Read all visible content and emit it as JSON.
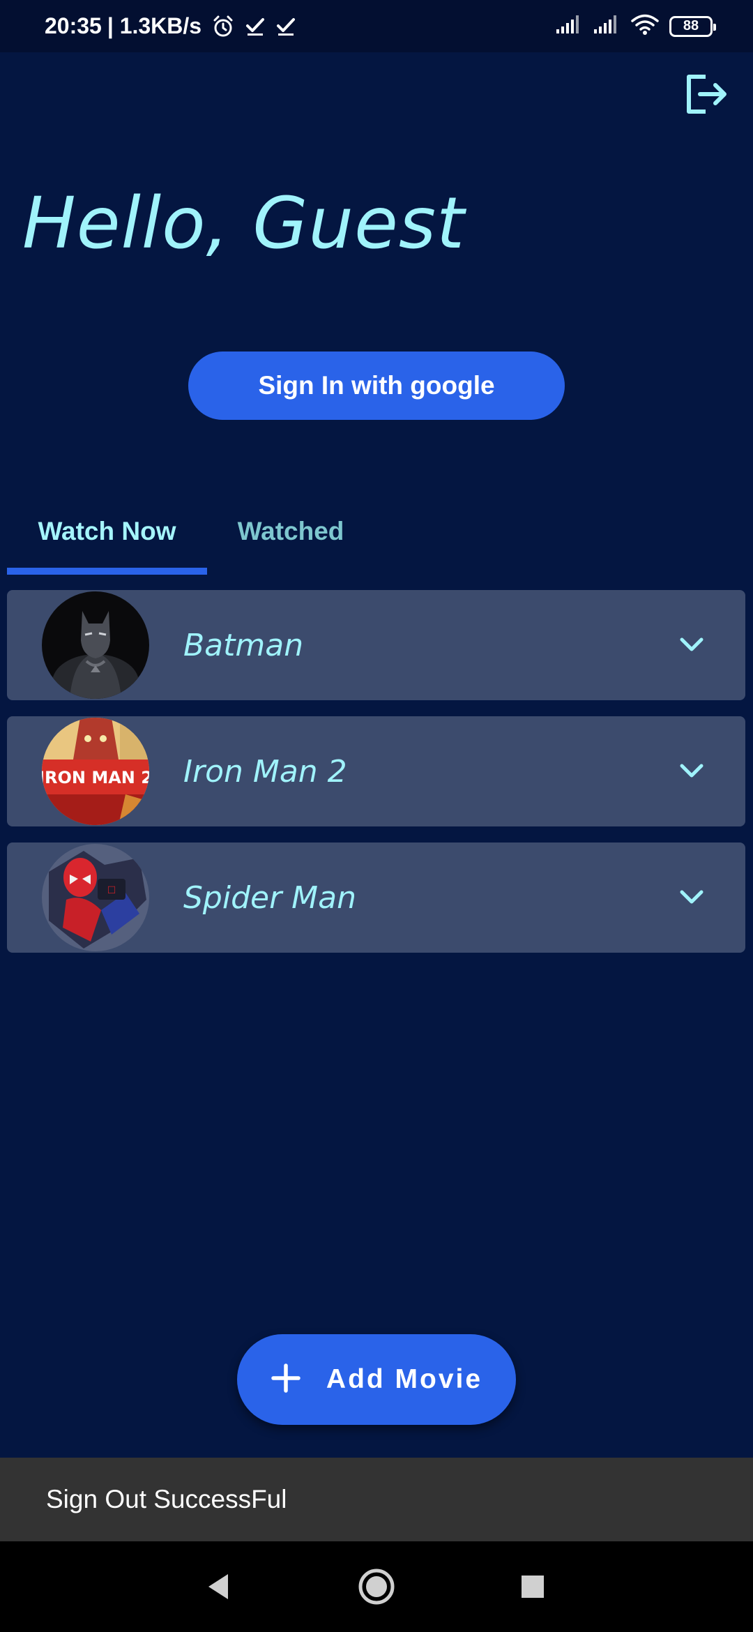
{
  "status_bar": {
    "time": "20:35",
    "network_speed": "| 1.3KB/s",
    "left_icons": [
      "alarm-icon",
      "download-done-icon",
      "download-done-icon"
    ],
    "right_icons": [
      "signal-icon",
      "signal-icon",
      "wifi-icon"
    ],
    "battery": "88"
  },
  "header": {
    "greeting": "Hello, Guest",
    "logout_icon": "logout-icon"
  },
  "auth": {
    "sign_in_label": "Sign In with google"
  },
  "tabs": [
    {
      "label": "Watch Now",
      "active": true
    },
    {
      "label": "Watched",
      "active": false
    }
  ],
  "movies": [
    {
      "title": "Batman",
      "poster": "batman-poster"
    },
    {
      "title": "Iron Man 2",
      "poster": "iron-man-2-poster",
      "poster_text": "IRON MAN 2"
    },
    {
      "title": "Spider Man",
      "poster": "spider-man-poster"
    }
  ],
  "fab": {
    "icon": "plus-icon",
    "label": "Add Movie"
  },
  "snackbar": {
    "message": "Sign Out SuccessFul"
  },
  "nav_bar": {
    "icons": [
      "back-icon",
      "home-icon",
      "recents-icon"
    ]
  },
  "colors": {
    "background": "#041641",
    "accent": "#2a63e9",
    "card": "#3c4b6d",
    "text_accent": "#a0f3fb",
    "snackbar": "#333333"
  }
}
